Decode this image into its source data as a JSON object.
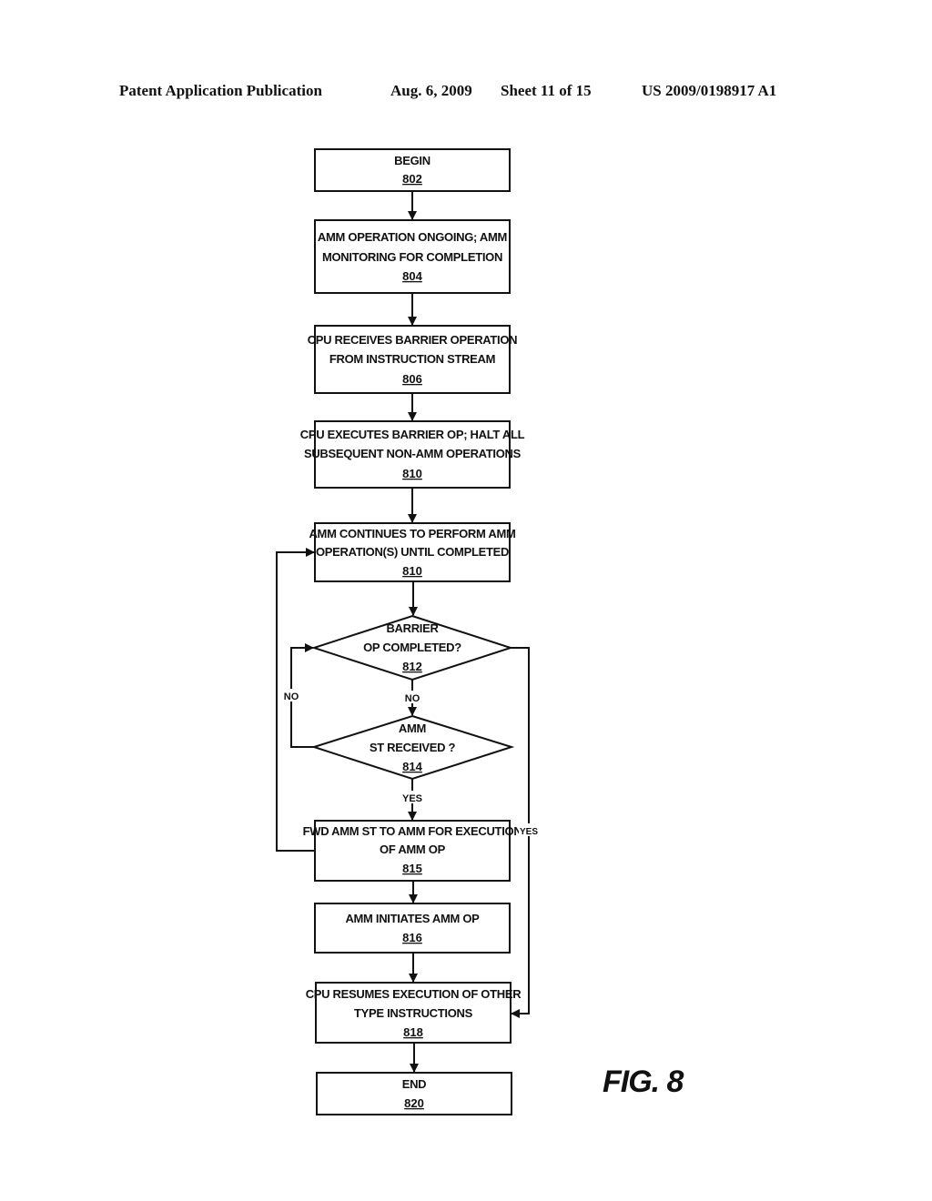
{
  "header": {
    "publication": "Patent Application Publication",
    "date": "Aug. 6, 2009",
    "sheet": "Sheet 11 of 15",
    "number": "US 2009/0198917 A1"
  },
  "figure_label": "FIG. 8",
  "nodes": {
    "n802": {
      "lines": [
        "BEGIN"
      ],
      "ref": "802"
    },
    "n804": {
      "lines": [
        "AMM OPERATION ONGOING; AMM",
        "MONITORING FOR COMPLETION"
      ],
      "ref": "804"
    },
    "n806": {
      "lines": [
        "CPU RECEIVES BARRIER OPERATION",
        "FROM INSTRUCTION STREAM"
      ],
      "ref": "806"
    },
    "n810a": {
      "lines": [
        "CPU EXECUTES BARRIER OP; HALT ALL",
        "SUBSEQUENT NON-AMM OPERATIONS"
      ],
      "ref": "810"
    },
    "n810b": {
      "lines": [
        "AMM CONTINUES TO PERFORM AMM",
        "OPERATION(S) UNTIL COMPLETED"
      ],
      "ref": "810"
    },
    "n812": {
      "lines": [
        "BARRIER",
        "OP COMPLETED?"
      ],
      "ref": "812"
    },
    "n814": {
      "lines": [
        "AMM",
        "ST RECEIVED ?"
      ],
      "ref": "814"
    },
    "n815": {
      "lines": [
        "FWD AMM ST TO AMM FOR EXECUTION",
        "OF AMM OP"
      ],
      "ref": "815"
    },
    "n816": {
      "lines": [
        "AMM INITIATES AMM OP"
      ],
      "ref": "816"
    },
    "n818": {
      "lines": [
        "CPU RESUMES EXECUTION OF OTHER",
        "TYPE INSTRUCTIONS"
      ],
      "ref": "818"
    },
    "n820": {
      "lines": [
        "END"
      ],
      "ref": "820"
    }
  },
  "edge_labels": {
    "no_812_to_814": "NO",
    "no_814_loop": "NO",
    "yes_814_to_815": "YES",
    "yes_812_to_818": "YES"
  }
}
